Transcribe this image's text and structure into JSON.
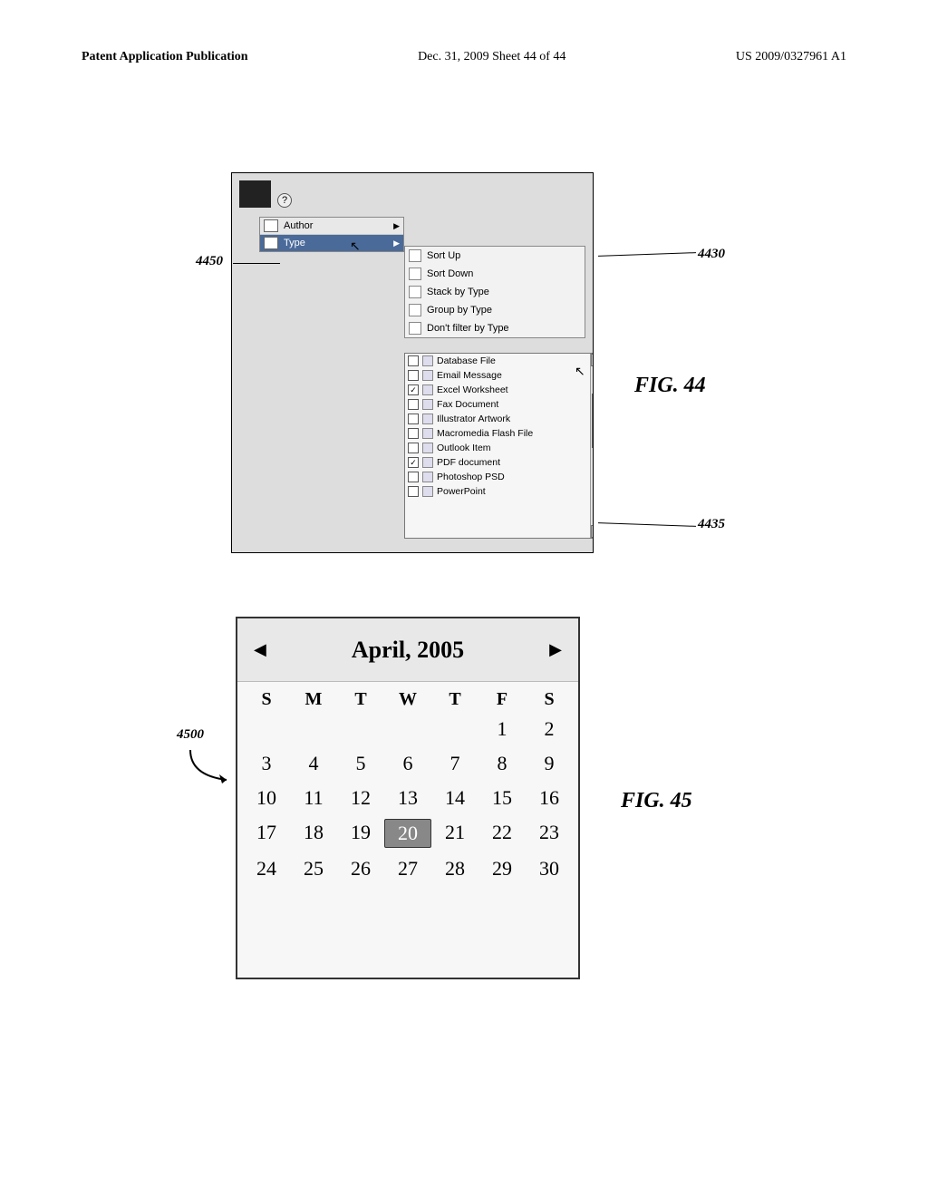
{
  "header": {
    "left": "Patent Application Publication",
    "center": "Dec. 31, 2009  Sheet 44 of 44",
    "right": "US 2009/0327961 A1"
  },
  "fig44": {
    "callouts": {
      "a": "4450",
      "b": "4430",
      "c": "4435"
    },
    "title": "FIG. 44",
    "sortMenu": [
      {
        "label": "Author",
        "arrow": true,
        "hl": false
      },
      {
        "label": "Type",
        "arrow": true,
        "hl": true
      }
    ],
    "submenu": [
      "Sort Up",
      "Sort Down",
      "Stack by Type",
      "Group by Type",
      "Don't filter by Type"
    ],
    "filterList": [
      {
        "checked": false,
        "label": "Database File"
      },
      {
        "checked": false,
        "label": "Email Message"
      },
      {
        "checked": true,
        "label": "Excel Worksheet"
      },
      {
        "checked": false,
        "label": "Fax Document"
      },
      {
        "checked": false,
        "label": "Illustrator Artwork"
      },
      {
        "checked": false,
        "label": "Macromedia Flash File"
      },
      {
        "checked": false,
        "label": "Outlook Item"
      },
      {
        "checked": true,
        "label": "PDF document"
      },
      {
        "checked": false,
        "label": "Photoshop PSD"
      },
      {
        "checked": false,
        "label": "PowerPoint"
      }
    ]
  },
  "fig45": {
    "callout": "4500",
    "title": "FIG. 45",
    "calendar": {
      "month": "April, 2005",
      "days": [
        "S",
        "M",
        "T",
        "W",
        "T",
        "F",
        "S"
      ],
      "leadingBlanks": 5,
      "dates": [
        1,
        2,
        3,
        4,
        5,
        6,
        7,
        8,
        9,
        10,
        11,
        12,
        13,
        14,
        15,
        16,
        17,
        18,
        19,
        20,
        21,
        22,
        23,
        24,
        25,
        26,
        27,
        28,
        29,
        30
      ],
      "selected": 20
    }
  }
}
